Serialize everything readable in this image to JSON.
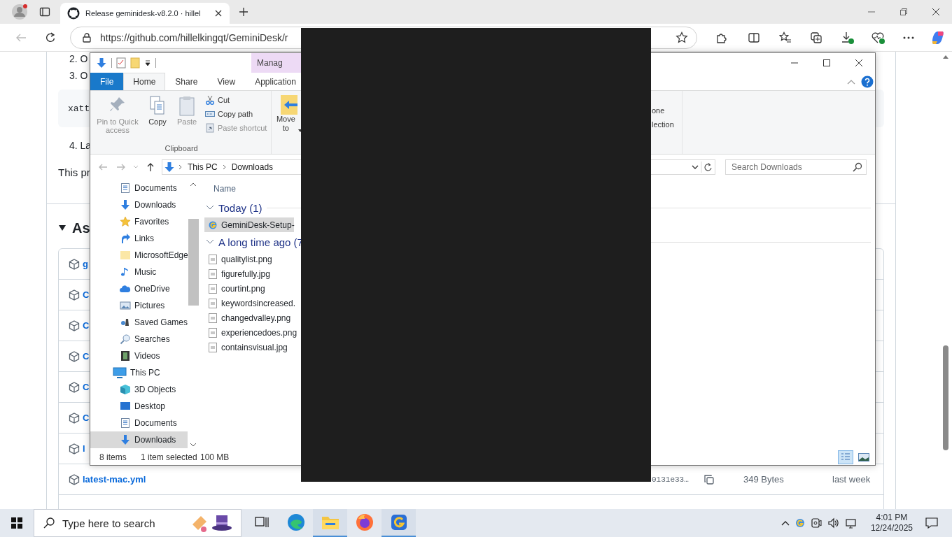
{
  "browser": {
    "tab_title": "Release geminidesk-v8.2.0 · hillel",
    "url": "https://github.com/hillelkingqt/GeminiDesk/r"
  },
  "page": {
    "steps": [
      "2. O",
      "3. O"
    ],
    "code": "xatt",
    "step_4": "4. La",
    "paragraph": "This pr",
    "assets_heading": "As",
    "asset_rows": [
      {
        "name": "g"
      },
      {
        "name": "C"
      },
      {
        "name": "C"
      },
      {
        "name": "C"
      },
      {
        "name": "C"
      },
      {
        "name": "C"
      },
      {
        "name": "l"
      },
      {
        "name": "latest-mac.yml",
        "hash": "0131e33…",
        "size": "349 Bytes",
        "date": "last week"
      }
    ]
  },
  "explorer": {
    "context_tab": "Manag",
    "ribbon_tabs": [
      {
        "label": "File",
        "kind": "file",
        "selected": false
      },
      {
        "label": "Home",
        "kind": "tab",
        "selected": true
      },
      {
        "label": "Share",
        "kind": "tab",
        "selected": false
      },
      {
        "label": "View",
        "kind": "tab",
        "selected": false
      },
      {
        "label": "Application",
        "kind": "context",
        "selected": false
      }
    ],
    "clipboard": {
      "large": [
        {
          "label": "Pin to Quick access",
          "kind": "pin",
          "disabled": true
        },
        {
          "label": "Copy",
          "kind": "copy",
          "disabled": false
        },
        {
          "label": "Paste",
          "kind": "paste",
          "disabled": true
        }
      ],
      "small": [
        {
          "label": "Cut",
          "kind": "cut",
          "disabled": false
        },
        {
          "label": "Copy path",
          "kind": "path",
          "disabled": false
        },
        {
          "label": "Paste shortcut",
          "kind": "shortcut",
          "disabled": true
        }
      ],
      "group_label": "Clipboard"
    },
    "move_to": "Move to",
    "select_fragments": [
      "one",
      "lection"
    ],
    "nav_buttons": [
      {
        "kind": "back",
        "disabled": true
      },
      {
        "kind": "forward",
        "disabled": true
      },
      {
        "kind": "recent",
        "disabled": true
      },
      {
        "kind": "up",
        "disabled": false
      }
    ],
    "breadcrumb": [
      "This PC",
      "Downloads"
    ],
    "search": {
      "placeholder": "Search Downloads"
    },
    "nav_pane": [
      {
        "label": "Documents",
        "kind": "documents",
        "selected": false
      },
      {
        "label": "Downloads",
        "kind": "downloads",
        "selected": false
      },
      {
        "label": "Favorites",
        "kind": "favorites",
        "selected": false
      },
      {
        "label": "Links",
        "kind": "links",
        "selected": false
      },
      {
        "label": "MicrosoftEdge",
        "kind": "folder",
        "selected": false
      },
      {
        "label": "Music",
        "kind": "music",
        "selected": false
      },
      {
        "label": "OneDrive",
        "kind": "onedrive",
        "selected": false
      },
      {
        "label": "Pictures",
        "kind": "pictures",
        "selected": false
      },
      {
        "label": "Saved Games",
        "kind": "games",
        "selected": false
      },
      {
        "label": "Searches",
        "kind": "searches",
        "selected": false
      },
      {
        "label": "Videos",
        "kind": "videos",
        "selected": false
      },
      {
        "label": "This PC",
        "kind": "pc",
        "selected": false,
        "children": [
          {
            "label": "3D Objects",
            "kind": "cube",
            "selected": false
          },
          {
            "label": "Desktop",
            "kind": "desktop",
            "selected": false
          },
          {
            "label": "Documents",
            "kind": "documents",
            "selected": false
          },
          {
            "label": "Downloads",
            "kind": "downloads",
            "selected": true
          }
        ]
      }
    ],
    "column_header": "Name",
    "groups": [
      {
        "title": "Today (1)",
        "expanded": true,
        "files": [
          {
            "name": "GeminiDesk-Setup-",
            "kind": "app",
            "selected": true
          }
        ]
      },
      {
        "title": "A long time ago (7",
        "expanded": true,
        "files": [
          {
            "name": "qualitylist.png",
            "kind": "image",
            "selected": false
          },
          {
            "name": "figurefully.jpg",
            "kind": "image",
            "selected": false
          },
          {
            "name": "courtint.png",
            "kind": "image",
            "selected": false
          },
          {
            "name": "keywordsincreased.",
            "kind": "image",
            "selected": false
          },
          {
            "name": "changedvalley.png",
            "kind": "image",
            "selected": false
          },
          {
            "name": "experiencedoes.png",
            "kind": "image",
            "selected": false
          },
          {
            "name": "containsvisual.jpg",
            "kind": "image",
            "selected": false
          }
        ]
      }
    ],
    "status": {
      "items": "8 items",
      "selection": "1 item selected",
      "size": "100 MB"
    },
    "views": [
      {
        "kind": "details",
        "selected": true
      },
      {
        "kind": "large",
        "selected": false
      }
    ]
  },
  "taskbar": {
    "search_placeholder": "Type here to search",
    "apps": [
      {
        "kind": "taskview",
        "running": false
      },
      {
        "kind": "edge",
        "running": false
      },
      {
        "kind": "explorer",
        "running": true
      },
      {
        "kind": "firefox",
        "running": false
      },
      {
        "kind": "gemini",
        "running": true
      }
    ],
    "time": "4:01 PM",
    "date": "12/24/2025"
  }
}
